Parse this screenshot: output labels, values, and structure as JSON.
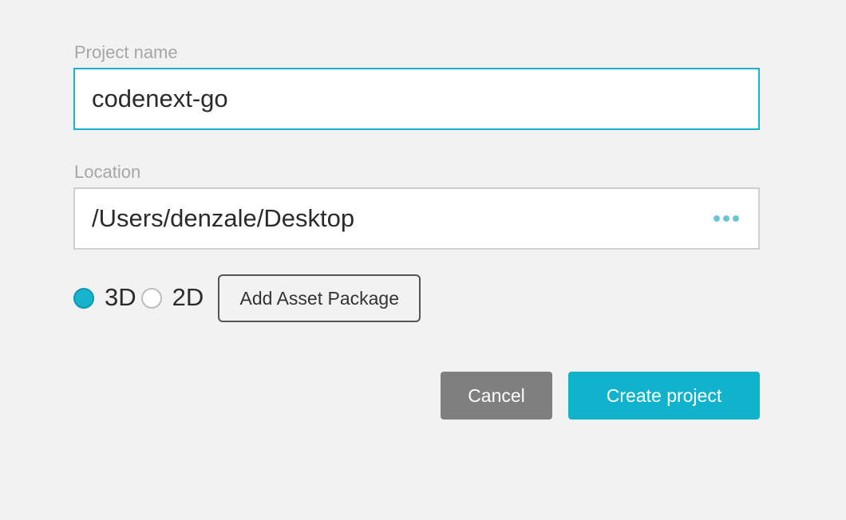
{
  "project_name": {
    "label": "Project name",
    "value": "codenext-go"
  },
  "location": {
    "label": "Location",
    "value": "/Users/denzale/Desktop",
    "browse_icon": "ellipsis-icon"
  },
  "dimension": {
    "options": [
      {
        "label": "3D",
        "selected": true
      },
      {
        "label": "2D",
        "selected": false
      }
    ]
  },
  "asset_package_button": "Add Asset Package",
  "actions": {
    "cancel": "Cancel",
    "create": "Create project"
  },
  "colors": {
    "accent": "#11b2cb",
    "cancel": "#7f7f7f",
    "background": "#f2f2f2"
  }
}
